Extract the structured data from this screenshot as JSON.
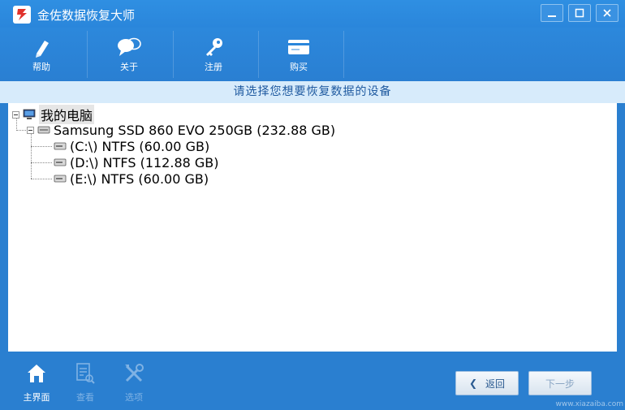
{
  "window": {
    "title": "金佐数据恢复大师",
    "controls": [
      "minimize",
      "maximize",
      "close"
    ]
  },
  "toolbar": {
    "items": [
      {
        "label": "帮助",
        "icon": "help-pen-icon"
      },
      {
        "label": "关于",
        "icon": "chat-bubbles-icon"
      },
      {
        "label": "注册",
        "icon": "key-icon"
      },
      {
        "label": "购买",
        "icon": "card-icon"
      }
    ]
  },
  "prompt": "请选择您想要恢复数据的设备",
  "tree": {
    "root": "我的电脑",
    "disk": "Samsung SSD 860 EVO 250GB (232.88 GB)",
    "partitions": [
      "(C:\\) NTFS (60.00 GB)",
      "(D:\\) NTFS (112.88 GB)",
      "(E:\\) NTFS (60.00 GB)"
    ]
  },
  "bottom_nav": [
    {
      "label": "主界面",
      "state": "active"
    },
    {
      "label": "查看",
      "state": "disabled"
    },
    {
      "label": "选项",
      "state": "disabled"
    }
  ],
  "buttons": {
    "back": "返回",
    "next": "下一步"
  },
  "watermark": "www.xiazaiba.com",
  "colors": {
    "titlebar": "#2f8fe2",
    "prompt_bg": "#d7ebfb",
    "prompt_text": "#1f5aa0",
    "bottom_bg": "#2a7fd0"
  }
}
